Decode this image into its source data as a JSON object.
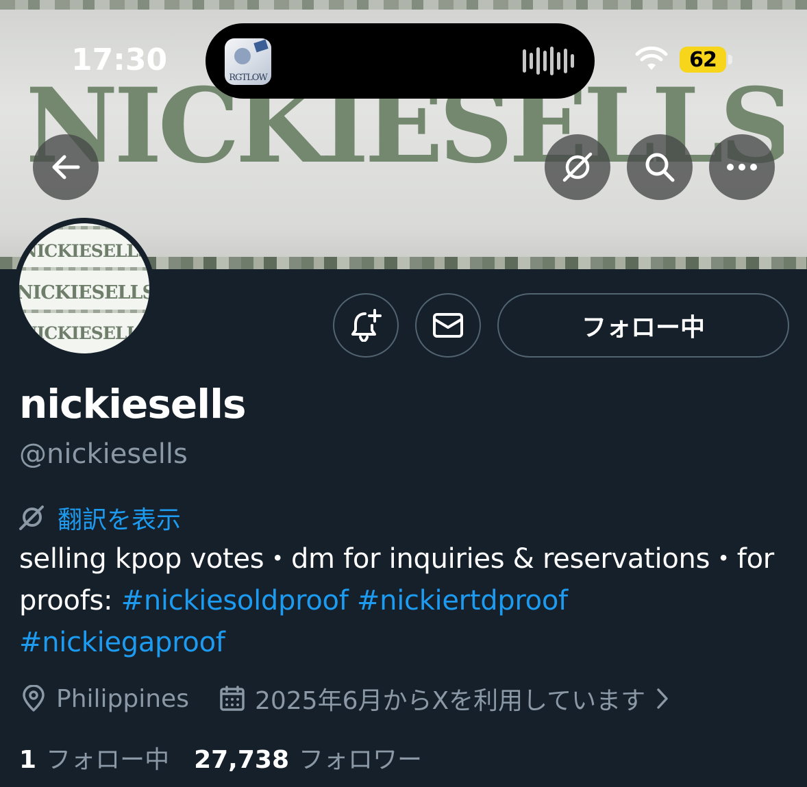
{
  "status_bar": {
    "time": "17:30",
    "battery": "62",
    "now_playing_art_text": "RGTLOW",
    "battery_color": "#f6d51b"
  },
  "banner": {
    "wordmark": "NICKIESELLS",
    "text_color": "#74886f"
  },
  "top_actions": {
    "back_icon": "arrow-left-icon",
    "translate_icon": "translate-icon",
    "search_icon": "search-icon",
    "more_icon": "more-icon"
  },
  "avatar": {
    "lines": [
      "NICKIESELLS",
      "NICKIESELLS",
      "NICKIESELLS"
    ]
  },
  "actions": {
    "notify_icon": "bell-plus-icon",
    "message_icon": "mail-icon",
    "follow_label": "フォロー中"
  },
  "profile": {
    "display_name": "nickiesells",
    "handle": "@nickiesells",
    "translate_label": "翻訳を表示",
    "bio_text": "selling kpop votes・dm for inquiries & reservations・for proofs: ",
    "hashtags": [
      "#nickiesoldproof",
      "#nickiertdproof",
      "#nickiegaproof"
    ],
    "location": "Philippines",
    "joined": "2025年6月からXを利用しています"
  },
  "stats": {
    "following_count": "1",
    "following_label": "フォロー中",
    "followers_count": "27,738",
    "followers_label": "フォロワー"
  },
  "colors": {
    "background": "#15202b",
    "link": "#1d9bf0",
    "secondary_text": "#8b98a5",
    "border": "#536471"
  }
}
